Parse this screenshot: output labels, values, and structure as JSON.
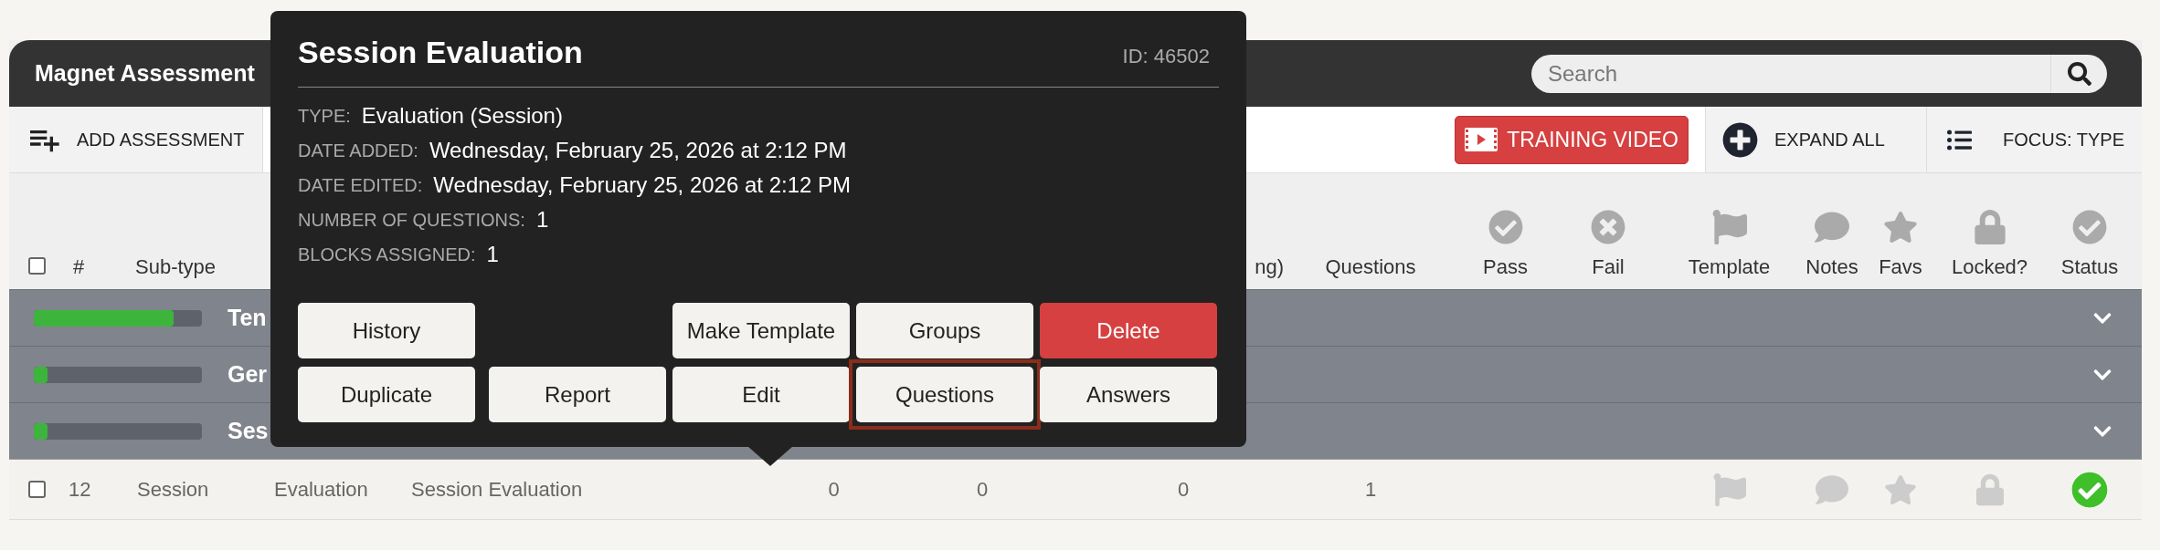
{
  "panel": {
    "title": "Magnet Assessment",
    "search": {
      "placeholder": "Search"
    }
  },
  "toolbar": {
    "add": "ADD ASSESSMENT",
    "video": "TRAINING VIDEO",
    "expand": "EXPAND ALL",
    "focus": "FOCUS: TYPE"
  },
  "table": {
    "select_all": {
      "checked": false
    },
    "columns": [
      {
        "label": "#"
      },
      {
        "label": "Sub-type"
      },
      {
        "label": "ng)",
        "kind": "cut"
      },
      {
        "label": "Questions"
      },
      {
        "label": "Pass",
        "kind": "icon"
      },
      {
        "label": "Fail",
        "kind": "icon"
      },
      {
        "label": "Template",
        "kind": "icon"
      },
      {
        "label": "Notes",
        "kind": "icon"
      },
      {
        "label": "Favs",
        "kind": "icon"
      },
      {
        "label": "Locked?",
        "kind": "icon"
      },
      {
        "label": "Status",
        "kind": "icon"
      }
    ],
    "groups": [
      {
        "title": "Ten",
        "level": 0.83,
        "expanded": false
      },
      {
        "title": "Ger",
        "level": 0.08,
        "expanded": false
      },
      {
        "title": "Ses",
        "level": 0.08,
        "expanded": false
      }
    ],
    "rows": [
      {
        "checked": false,
        "number": "12",
        "subtype": "Session",
        "type": "Evaluation",
        "name": "Session Evaluation",
        "counts": [
          "0",
          "0",
          "0"
        ],
        "questions": "1",
        "template": false,
        "notes": false,
        "fav": false,
        "locked": false,
        "complete": true
      }
    ]
  },
  "popup": {
    "title": "Session Evaluation",
    "id": "ID: 46502",
    "fields": [
      {
        "label": "TYPE:",
        "value": "Evaluation (Session)"
      },
      {
        "label": "DATE ADDED:",
        "value": "Wednesday, February 25, 2026 at 2:12 PM"
      },
      {
        "label": "DATE EDITED:",
        "value": "Wednesday, February 25, 2026 at 2:12 PM"
      },
      {
        "label": "NUMBER OF QUESTIONS:",
        "value": "1"
      },
      {
        "label": "BLOCKS ASSIGNED:",
        "value": "1"
      }
    ],
    "button_rows": [
      [
        {
          "label": "History",
          "kind": "default",
          "outlined": false
        },
        {
          "label": "Make Template",
          "kind": "default",
          "outlined": false
        },
        {
          "label": "Groups",
          "kind": "default",
          "outlined": false
        },
        {
          "label": "Delete",
          "kind": "danger",
          "outlined": false
        }
      ],
      [
        {
          "label": "Duplicate",
          "kind": "default",
          "outlined": false
        },
        {
          "label": "Report",
          "kind": "default",
          "outlined": false
        },
        {
          "label": "Edit",
          "kind": "default",
          "outlined": false
        },
        {
          "label": "Questions",
          "kind": "default",
          "outlined": true
        },
        {
          "label": "Answers",
          "kind": "default",
          "outlined": false
        }
      ]
    ]
  }
}
